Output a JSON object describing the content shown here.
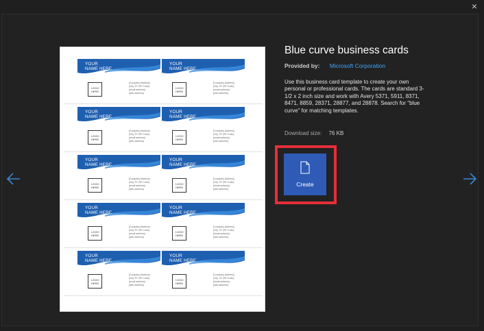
{
  "dialog": {
    "close_glyph": "×",
    "nav_prev": "left-arrow-icon",
    "nav_next": "right-arrow-icon"
  },
  "template": {
    "title": "Blue curve business cards",
    "provided_by_label": "Provided by:",
    "provider": "Microsoft Corporation",
    "description": "Use this business card template to create your own personal or professional cards. The cards are standard 3-1/2 x 2 inch size and work with Avery 5371, 5911, 8371, 8471, 8859, 28371, 28877, and 28878. Search for \"blue curve\" for matching templates.",
    "download_size_label": "Download size:",
    "download_size": "76 KB"
  },
  "create_button": {
    "label": "Create",
    "icon": "document-icon"
  },
  "preview_card": {
    "name_line1": "YOUR",
    "name_line2": "NAME HERE",
    "logo_line1": "LOGO",
    "logo_line2": "HERE",
    "info_line1": "[Company Address]",
    "info_line2": "[City, ST ZIP Code]",
    "info_line3": "[email address]",
    "info_line4": "[web address]"
  },
  "colors": {
    "accent": "#2f5bb7",
    "highlight": "#e62e3a",
    "link": "#3ea7ff",
    "card_blue": "#1f5fb0"
  }
}
